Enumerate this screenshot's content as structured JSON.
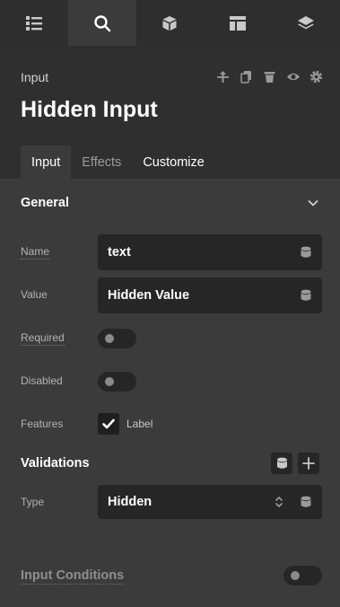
{
  "top_tabs": [
    {
      "icon": "list-icon"
    },
    {
      "icon": "search-icon",
      "active": true
    },
    {
      "icon": "cube-icon"
    },
    {
      "icon": "layout-icon"
    },
    {
      "icon": "layers-icon"
    }
  ],
  "header": {
    "label": "Input",
    "title": "Hidden Input",
    "actions": [
      "pin-icon",
      "copy-icon",
      "trash-icon",
      "eye-icon",
      "gear-icon"
    ]
  },
  "panel_tabs": [
    "Input",
    "Effects",
    "Customize"
  ],
  "general": {
    "title": "General",
    "name_label": "Name",
    "name_value": "text",
    "value_label": "Value",
    "value_value": "Hidden Value",
    "required_label": "Required",
    "disabled_label": "Disabled",
    "features_label": "Features",
    "features_checkbox_label": "Label",
    "features_checked": true
  },
  "validations": {
    "title": "Validations",
    "type_label": "Type",
    "type_value": "Hidden"
  },
  "input_conditions": {
    "title": "Input Conditions"
  },
  "colors": {
    "topbar": "#2e2e2f",
    "header": "#2f2f30",
    "panel": "#3b3b3c",
    "field": "#262627"
  }
}
